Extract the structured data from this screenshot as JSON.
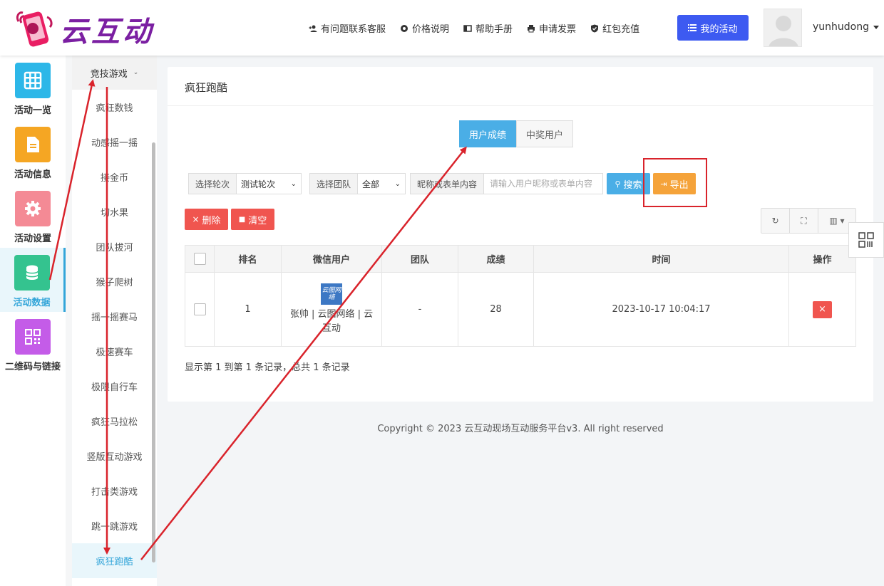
{
  "header": {
    "logo_text": "云互动",
    "nav": [
      {
        "label": "有问题联系客服",
        "icon": "add-user-icon"
      },
      {
        "label": "价格说明",
        "icon": "gear-icon"
      },
      {
        "label": "帮助手册",
        "icon": "book-icon"
      },
      {
        "label": "申请发票",
        "icon": "printer-icon"
      },
      {
        "label": "红包充值",
        "icon": "shield-check-icon"
      }
    ],
    "my_activity": "我的活动",
    "username": "yunhudong"
  },
  "icon_sidebar": [
    {
      "label": "活动一览",
      "icon": "grid-icon",
      "color": "#2db7e8"
    },
    {
      "label": "活动信息",
      "icon": "document-icon",
      "color": "#f5a623"
    },
    {
      "label": "活动设置",
      "icon": "settings-icon",
      "color": "#f48a95"
    },
    {
      "label": "活动数据",
      "icon": "database-icon",
      "color": "#34c38f",
      "active": true
    },
    {
      "label": "二维码与链接",
      "icon": "qrcode-icon",
      "color": "#c45ce8"
    }
  ],
  "submenu": {
    "group": "竞技游戏",
    "items": [
      "疯狂数钱",
      "动感摇一摇",
      "接金币",
      "切水果",
      "团队拔河",
      "猴子爬树",
      "摇一摇赛马",
      "极速赛车",
      "极限自行车",
      "疯狂马拉松",
      "竖版互动游戏",
      "打击类游戏",
      "跳一跳游戏",
      "疯狂跑酷"
    ],
    "active": "疯狂跑酷"
  },
  "card": {
    "title": "疯狂跑酷",
    "tabs": [
      "用户成绩",
      "中奖用户"
    ],
    "filters": {
      "round_label": "选择轮次",
      "round_value": "测试轮次",
      "team_label": "选择团队",
      "team_value": "全部",
      "keyword_label": "昵称或表单内容",
      "keyword_placeholder": "请输入用户昵称或表单内容"
    },
    "buttons": {
      "search": "搜索",
      "export": "导出",
      "delete": "删除",
      "clear": "清空"
    },
    "table": {
      "columns": [
        "排名",
        "微信用户",
        "团队",
        "成绩",
        "时间",
        "操作"
      ],
      "rows": [
        {
          "rank": "1",
          "user": "张帅 | 云图网络 | 云互动",
          "avatar_text": "云图网络",
          "team": "-",
          "score": "28",
          "time": "2023-10-17 10:04:17"
        }
      ]
    },
    "records": "显示第 1 到第 1 条记录，总共 1 条记录"
  },
  "copyright": "Copyright © 2023 云互动现场互动服务平台v3. All right reserved",
  "colors": {
    "primary_blue": "#3d5af1",
    "tab_active": "#4aaee6",
    "danger": "#f0554f",
    "warning": "#f5a33a",
    "annotation_red": "#d9232b"
  }
}
